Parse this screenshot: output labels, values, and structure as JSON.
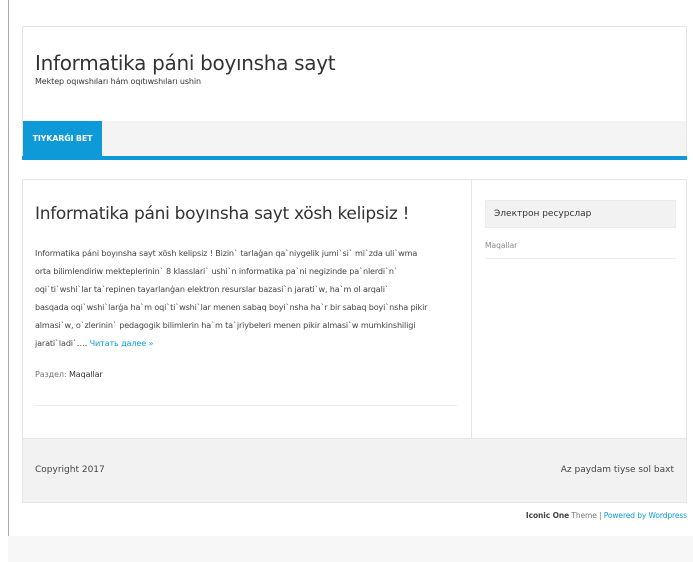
{
  "header": {
    "site_title": "Informatika páni boyınsha sayt",
    "site_description": "Mektep oqıwshıları hám oqıtıwshıları ushin"
  },
  "nav": {
    "items": [
      {
        "label": "TIYKARǴI BET"
      }
    ]
  },
  "post": {
    "title": "Informatika páni boyınsha sayt xösh kelipsiz !",
    "body_lines": [
      "Informatika páni boyınsha sayt xösh kelipsiz ! Bizin` tarlaǵan qa`niygelik jumi`si` mi`zda uli`wma",
      "orta bilimlendiriw mekteplerinin` 8 klasslari` ushi`n informatika pa`ni negizinde pa`nlerdi`n`",
      "oqi`ti`wshi`lar ta`repinen tayarlanǵan   elektron resurslar bazasi`n jarati`w, ha`m ol arqali`",
      "basqada oqi`wshi`larǵa  ha`m oqi`ti`wshi`lar menen sabaq boyi`nsha ha`r bir sabaq boyi`nsha pikir",
      "almasi`w, o`zlerinin` pedagogik bilimlerin ha`m ta`jriybeleri menen pikir almasi`w mumkinshiligi"
    ],
    "last_line": "jarati`ladi`…. ",
    "read_more": "Читать далее »",
    "meta_label": "Раздел: ",
    "category": "Maqallar"
  },
  "sidebar": {
    "widget_title": "Электрон ресурслар",
    "items": [
      {
        "label": "Maqallar"
      }
    ]
  },
  "footer": {
    "copyright": "Copyright 2017",
    "tagline": "Az paydam tiyse sol baxt"
  },
  "credits": {
    "theme_name": "Iconic One",
    "theme_word": " Theme",
    "separator": " | ",
    "powered_by": "Powered by Wordpress"
  },
  "colors": {
    "accent": "#0e9ad8",
    "nav_bg": "#f4f4f4",
    "footer_bg": "#f2f2f2",
    "text": "#444444"
  }
}
